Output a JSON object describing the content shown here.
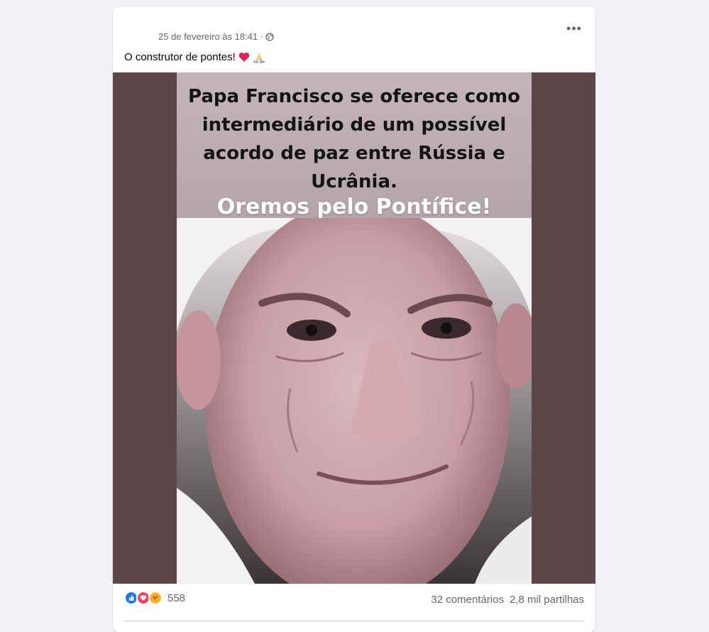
{
  "post": {
    "timestamp": "25 de fevereiro às 18:41",
    "separator": "·",
    "privacy_icon": "globe-icon",
    "more_icon": "more-options-icon",
    "more_label": "•••",
    "caption": "O construtor de pontes!",
    "caption_emoji": [
      "red-heart-emoji",
      "folded-hands-emoji"
    ]
  },
  "image": {
    "headline": "Papa Francisco se oferece como intermediário de um possível acordo de paz entre Rússia e Ucrânia.",
    "subline": "Oremos pelo Pontífice!",
    "banner_color": "#b9aab0",
    "frame_color": "#5c4649"
  },
  "footer": {
    "reaction_icons": [
      "like-icon",
      "love-icon",
      "care-icon"
    ],
    "reaction_count": "558",
    "comments": "32 comentários",
    "shares": "2,8 mil partilhas",
    "like_color": "#1877f2",
    "love_color": "#f33e58",
    "care_color": "#f7b125"
  }
}
